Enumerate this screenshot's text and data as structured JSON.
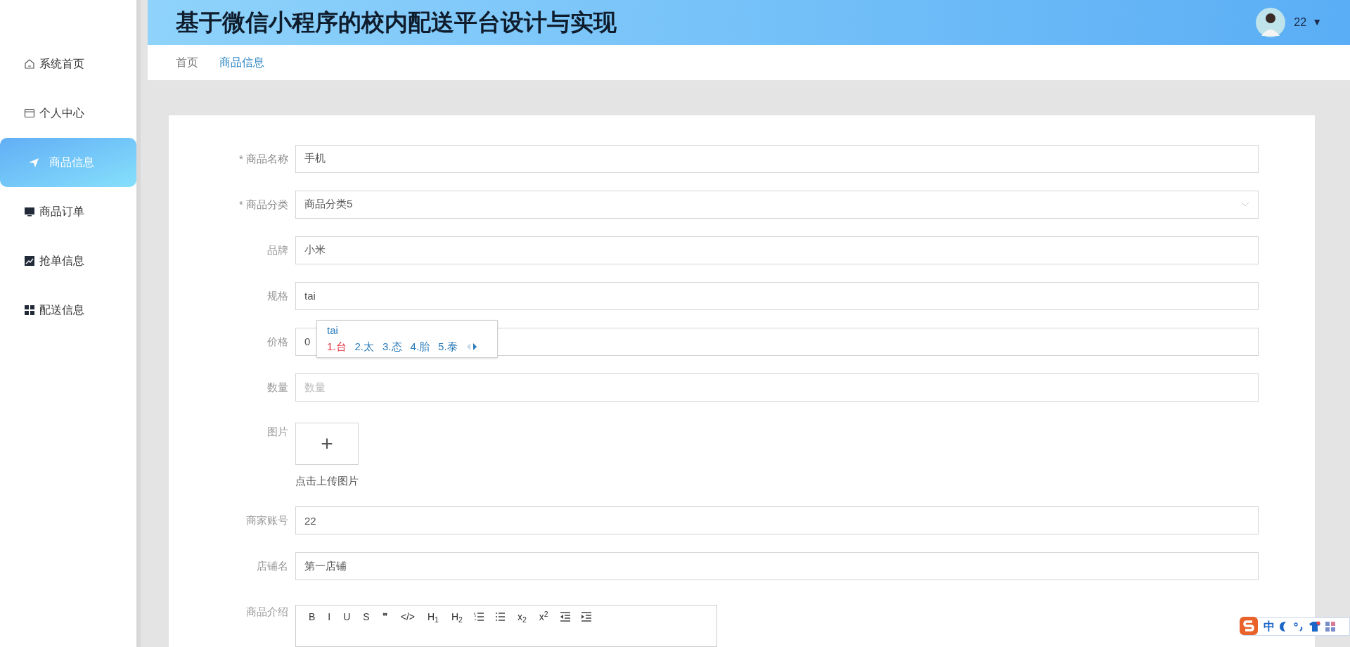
{
  "sidebar": {
    "items": [
      {
        "label": "系统首页",
        "selected": false
      },
      {
        "label": "个人中心",
        "selected": false
      },
      {
        "label": "商品信息",
        "selected": true
      },
      {
        "label": "商品订单",
        "selected": false
      },
      {
        "label": "抢单信息",
        "selected": false
      },
      {
        "label": "配送信息",
        "selected": false
      }
    ]
  },
  "header": {
    "title": "基于微信小程序的校内配送平台设计与实现",
    "user": "22",
    "caret": "▼"
  },
  "breadcrumb": [
    {
      "label": "首页",
      "selected": false
    },
    {
      "label": "商品信息",
      "selected": true
    }
  ],
  "form": {
    "fields": [
      {
        "kind": "input",
        "mark": "*",
        "label": "商品名称",
        "required": true,
        "value": "手机"
      },
      {
        "kind": "select",
        "mark": "*",
        "label": "商品分类",
        "required": true,
        "value": "商品分类5"
      },
      {
        "kind": "input",
        "label": "品牌",
        "required": false,
        "value": "小米"
      },
      {
        "kind": "input",
        "label": "规格",
        "required": false,
        "value": "tai"
      },
      {
        "kind": "input",
        "label": "价格",
        "required": false,
        "value": "0"
      },
      {
        "kind": "input",
        "label": "数量",
        "required": false,
        "placeholder": "数量"
      },
      {
        "kind": "upload",
        "label": "图片",
        "required": false,
        "icon": "+",
        "hint": "点击上传图片"
      },
      {
        "kind": "input",
        "label": "商家账号",
        "required": false,
        "value": "22"
      },
      {
        "kind": "input",
        "label": "店铺名",
        "required": false,
        "value": "第一店铺"
      },
      {
        "kind": "editor",
        "label": "商品介绍",
        "required": false,
        "toolbar": [
          {
            "kind": "text",
            "label": "B"
          },
          {
            "kind": "text",
            "label": "I"
          },
          {
            "kind": "text",
            "label": "U"
          },
          {
            "kind": "text",
            "label": "S"
          },
          {
            "kind": "text",
            "label": "❞"
          },
          {
            "kind": "text",
            "label": "</>"
          },
          {
            "kind": "text",
            "label": "H$_{1}$"
          },
          {
            "kind": "text",
            "label": "H$_{2}$"
          },
          {
            "kind": "ol"
          },
          {
            "kind": "ul"
          },
          {
            "kind": "text",
            "label": "x$_{2}$"
          },
          {
            "kind": "text",
            "label": "x$^{2}$"
          },
          {
            "kind": "outdent"
          },
          {
            "kind": "indent"
          }
        ]
      }
    ]
  },
  "ime_popup": {
    "composition": "tai",
    "candidates": [
      {
        "label": "1.台",
        "selected": true
      },
      {
        "label": "2.太",
        "selected": false
      },
      {
        "label": "3.态",
        "selected": false
      },
      {
        "label": "4.胎",
        "selected": false
      },
      {
        "label": "5.泰",
        "selected": false
      }
    ]
  },
  "ime_bar": {
    "mode": "中"
  }
}
